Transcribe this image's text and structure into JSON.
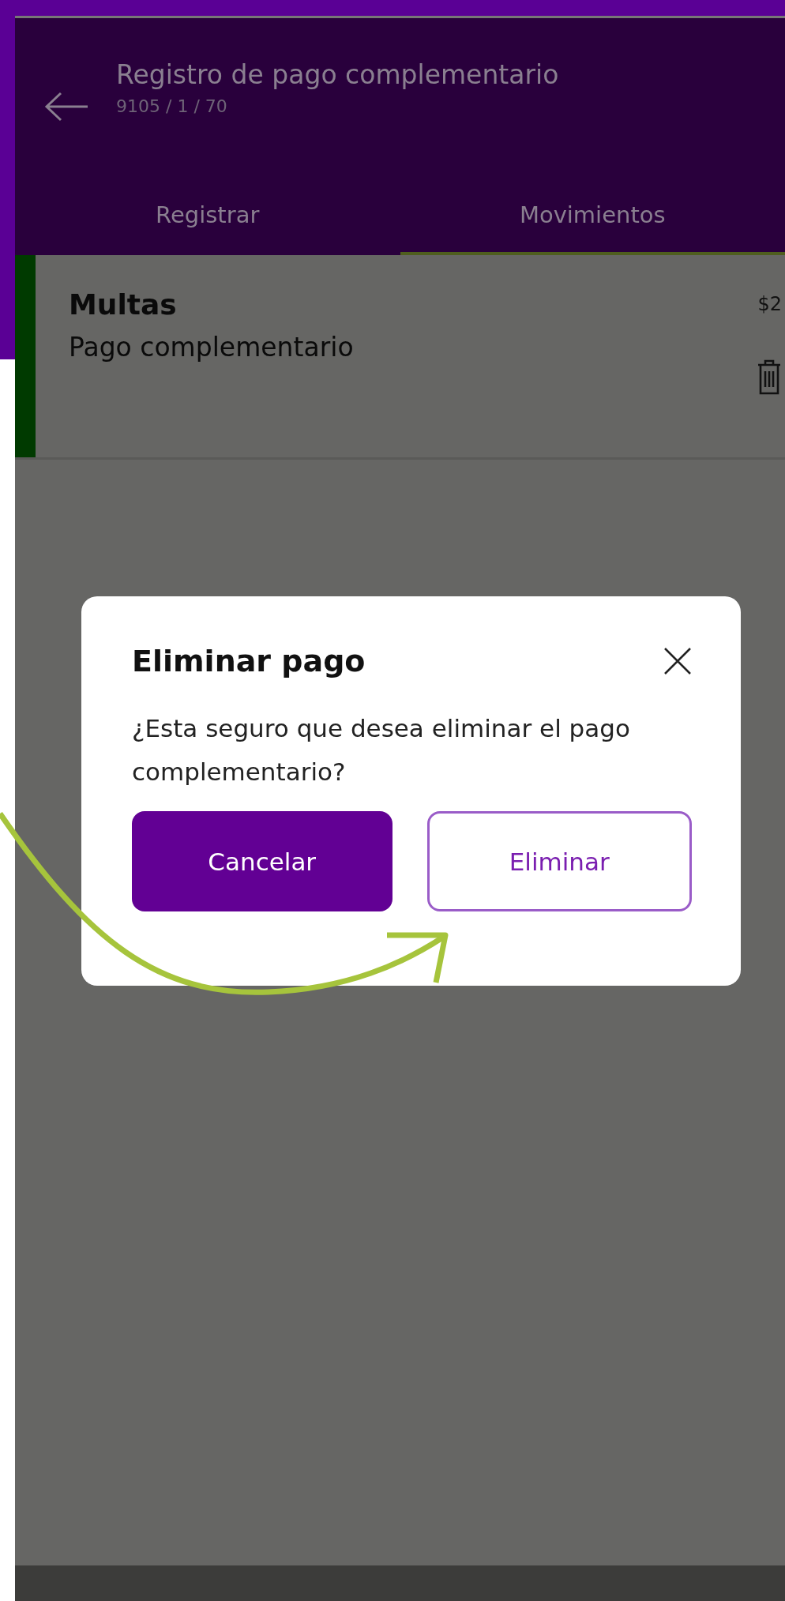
{
  "header": {
    "title": "Registro de pago complementario",
    "subtitle": "9105 / 1 / 70"
  },
  "tabs": [
    {
      "label": "Registrar",
      "selected": false
    },
    {
      "label": "Movimientos",
      "selected": true
    }
  ],
  "movements": [
    {
      "title": "Multas",
      "description": "Pago complementario",
      "amount": "$2"
    }
  ],
  "dialog": {
    "title": "Eliminar pago",
    "message": "¿Esta seguro que desea eliminar el pago complementario?",
    "buttons": [
      {
        "label": "Cancelar",
        "kind": "primary"
      },
      {
        "label": "Eliminar",
        "kind": "outline"
      }
    ]
  }
}
